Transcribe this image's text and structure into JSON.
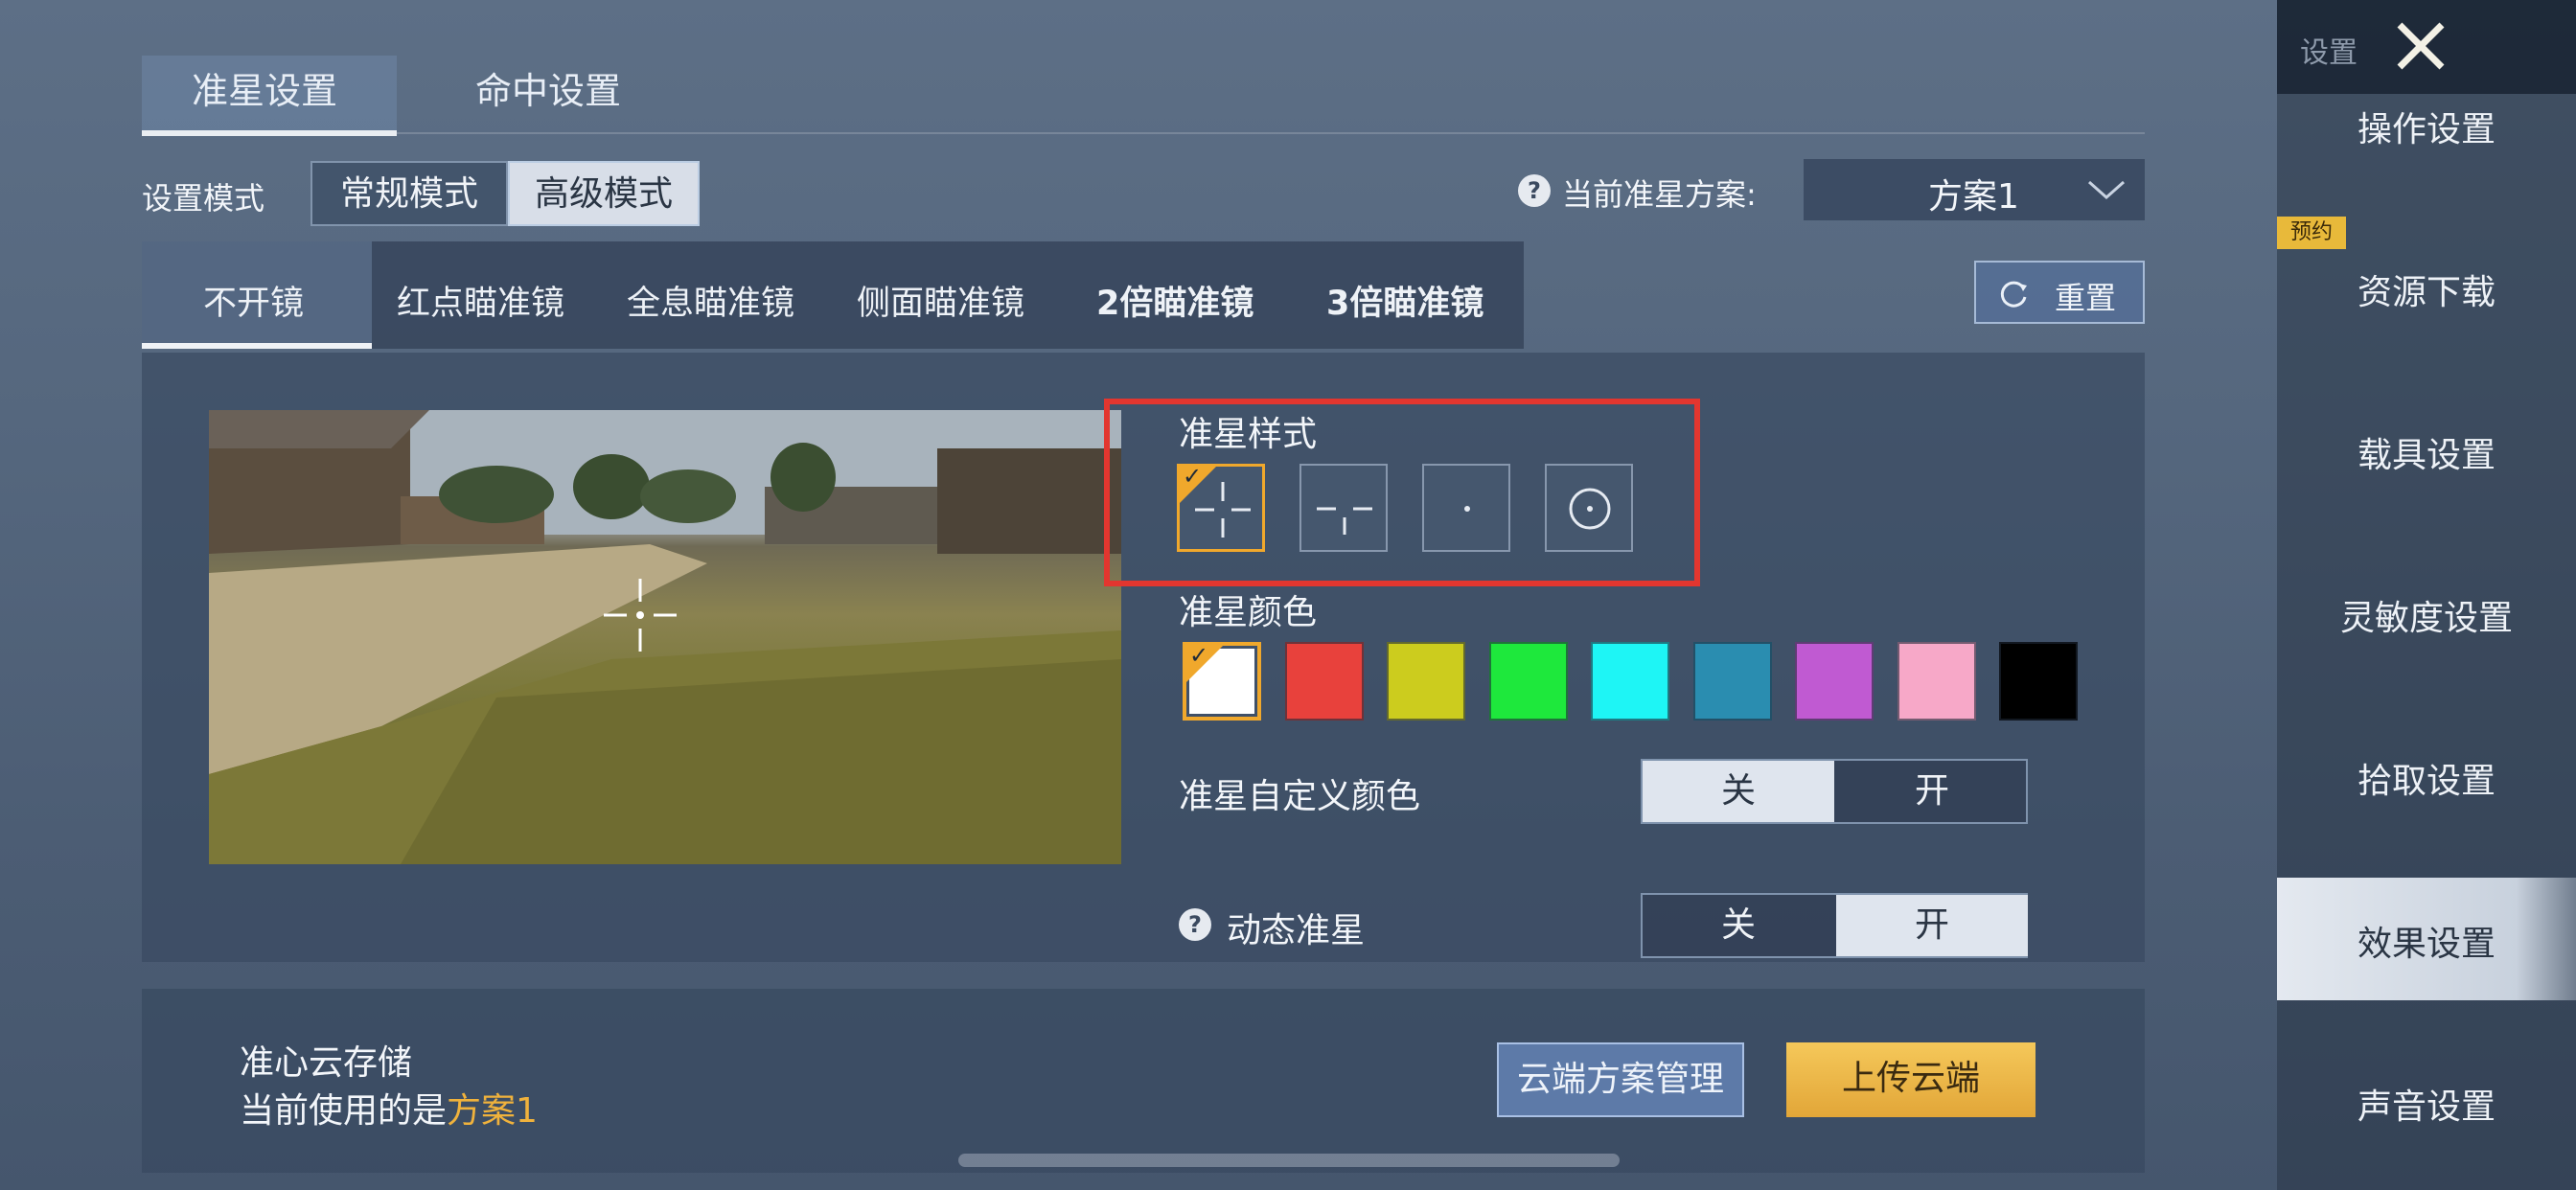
{
  "top_tabs": [
    {
      "label": "准星设置",
      "active": true
    },
    {
      "label": "命中设置",
      "active": false
    }
  ],
  "mode": {
    "label": "设置模式",
    "options": [
      "常规模式",
      "高级模式"
    ],
    "selected": "高级模式"
  },
  "scheme": {
    "label": "当前准星方案:",
    "value": "方案1",
    "help": "?"
  },
  "scope_tabs": [
    "不开镜",
    "红点瞄准镜",
    "全息瞄准镜",
    "侧面瞄准镜",
    "2倍瞄准镜",
    "3倍瞄准镜"
  ],
  "scope_selected": "不开镜",
  "reset_label": "重置",
  "crosshair_style": {
    "label": "准星样式",
    "options": [
      "crosshair-gap-icon",
      "crosshair-t-icon",
      "crosshair-dot-icon",
      "crosshair-circle-icon"
    ],
    "selected_index": 0
  },
  "crosshair_color": {
    "label": "准星颜色",
    "colors": [
      "#ffffff",
      "#e8413c",
      "#cccc1e",
      "#1ee83c",
      "#1ef5f5",
      "#2a8db0",
      "#c05ad2",
      "#f7a8c8",
      "#000000"
    ],
    "selected_index": 0
  },
  "custom_color": {
    "label": "准星自定义颜色",
    "off": "关",
    "on": "开",
    "state": "off"
  },
  "dynamic_crosshair": {
    "label": "动态准星",
    "help": "?",
    "off": "关",
    "on": "开",
    "state": "on"
  },
  "cloud": {
    "title": "准心云存储",
    "current_prefix": "当前使用的是",
    "current_value": "方案1",
    "manage_label": "云端方案管理",
    "upload_label": "上传云端"
  },
  "sidebar": {
    "header": "设置",
    "badge": "预约",
    "items": [
      "操作设置",
      "资源下载",
      "载具设置",
      "灵敏度设置",
      "拾取设置",
      "效果设置",
      "声音设置"
    ],
    "active": "效果设置"
  }
}
